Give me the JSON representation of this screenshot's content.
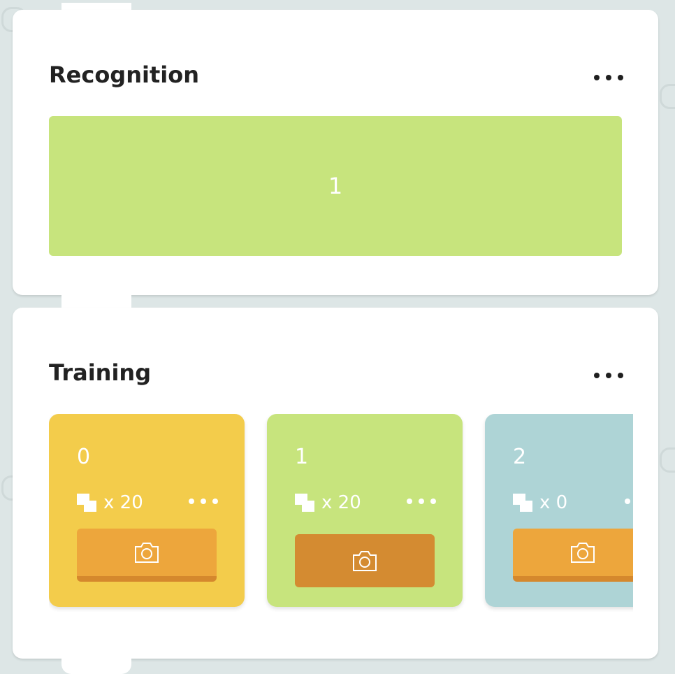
{
  "recognition": {
    "title": "Recognition",
    "result_label": "1"
  },
  "training": {
    "title": "Training",
    "classes": [
      {
        "label": "0",
        "count": "x 20",
        "color": "#f3cc4b"
      },
      {
        "label": "1",
        "count": "x 20",
        "color": "#c7e47d"
      },
      {
        "label": "2",
        "count": "x 0",
        "color": "#aed4d6"
      }
    ]
  },
  "icons": {
    "more": "more-horizontal-icon",
    "camera": "camera-icon",
    "samples": "image-stack-icon"
  },
  "colors": {
    "background": "#dde6e6",
    "panel": "#ffffff",
    "camera_button": "#eda63c",
    "camera_button_pressed": "#d48b31"
  }
}
